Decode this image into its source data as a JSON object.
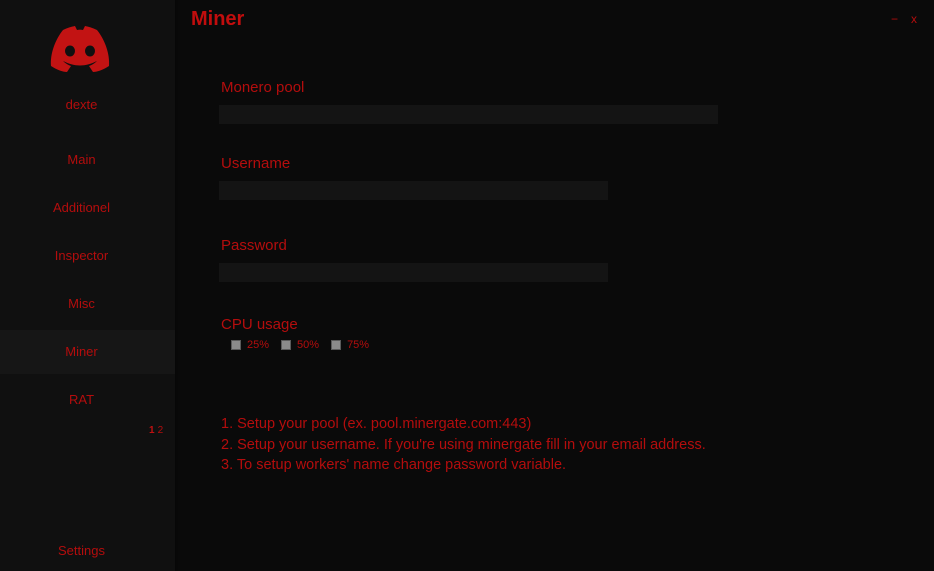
{
  "sidebar": {
    "logo_icon": "discord-logo-icon",
    "username": "dexte",
    "items": [
      {
        "label": "Main"
      },
      {
        "label": "Additionel"
      },
      {
        "label": "Inspector"
      },
      {
        "label": "Misc"
      },
      {
        "label": "Miner"
      },
      {
        "label": "RAT"
      }
    ],
    "active_item": "Miner",
    "pager": [
      "1",
      "2"
    ],
    "settings_label": "Settings"
  },
  "window": {
    "title": "Miner",
    "minimize_label": "−",
    "close_label": "x"
  },
  "form": {
    "pool_label": "Monero pool",
    "pool_value": "",
    "username_label": "Username",
    "username_value": "",
    "password_label": "Password",
    "password_value": "",
    "cpu_label": "CPU usage",
    "cpu_options": [
      "25%",
      "50%",
      "75%"
    ]
  },
  "instructions": [
    "1. Setup your pool (ex. pool.minergate.com:443)",
    "2. Setup your username. If you're using minergate fill in your email address.",
    "3. To setup workers' name change password variable."
  ],
  "colors": {
    "accent": "#b40d0d",
    "background": "#0a0a0a",
    "sidebar": "#101010"
  }
}
